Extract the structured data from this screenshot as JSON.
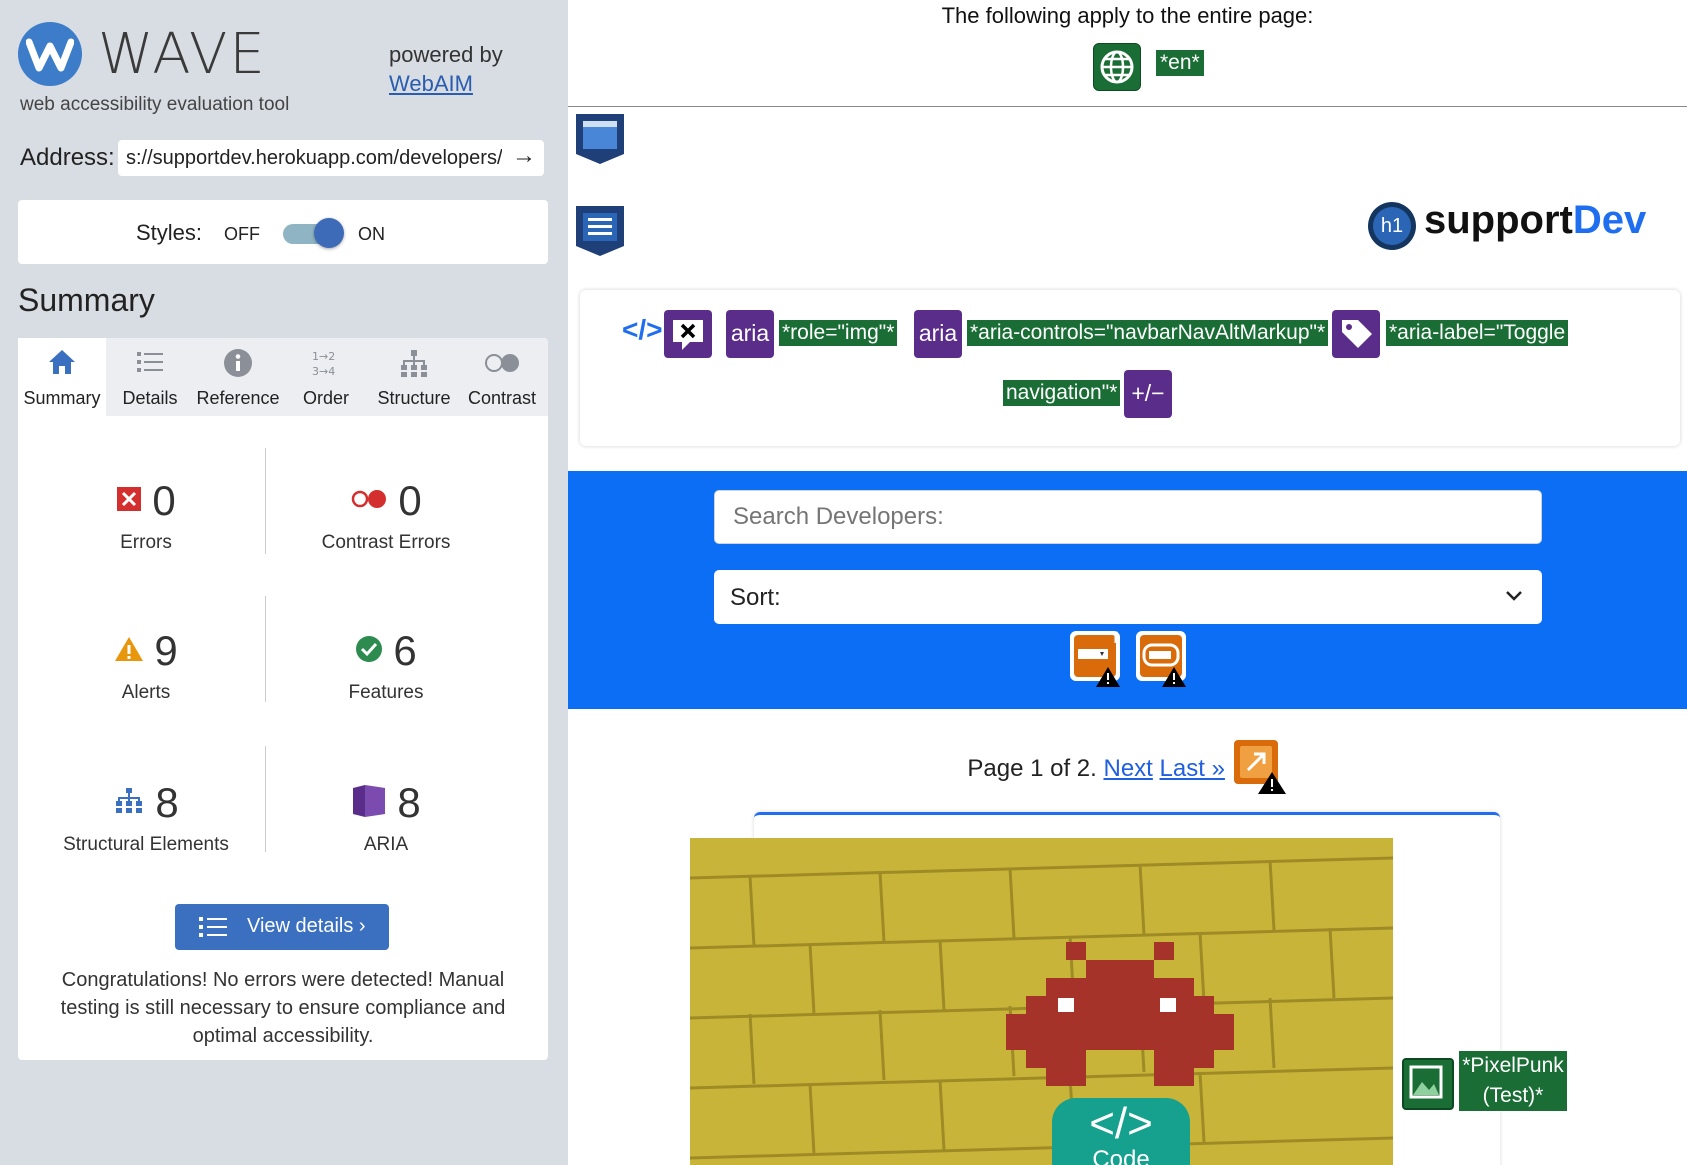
{
  "sidebar": {
    "brand": "WAVE",
    "tagline": "web accessibility evaluation tool",
    "powered_by": "powered by",
    "webaim_link": "WebAIM",
    "address_label": "Address:",
    "address_value": "s://supportdev.herokuapp.com/developers/",
    "styles_label": "Styles:",
    "styles_off": "OFF",
    "styles_on": "ON",
    "summary_heading": "Summary",
    "tabs": [
      {
        "label": "Summary",
        "icon": "home-icon"
      },
      {
        "label": "Details",
        "icon": "list-icon"
      },
      {
        "label": "Reference",
        "icon": "info-icon"
      },
      {
        "label": "Order",
        "icon": "order-icon"
      },
      {
        "label": "Structure",
        "icon": "structure-icon"
      },
      {
        "label": "Contrast",
        "icon": "contrast-icon"
      }
    ],
    "stats": {
      "errors": {
        "value": "0",
        "label": "Errors"
      },
      "contrast_errors": {
        "value": "0",
        "label": "Contrast Errors"
      },
      "alerts": {
        "value": "9",
        "label": "Alerts"
      },
      "features": {
        "value": "6",
        "label": "Features"
      },
      "structural": {
        "value": "8",
        "label": "Structural Elements"
      },
      "aria": {
        "value": "8",
        "label": "ARIA"
      }
    },
    "view_details": "View details ›",
    "congrats": "Congratulations! No errors were detected! Manual testing is still necessary to ensure compliance and optimal accessibility."
  },
  "main": {
    "apply_text": "The following apply to the entire page:",
    "lang_tag": "*en*",
    "brand_support": "support",
    "brand_dev": "Dev",
    "h1_badge": "h1",
    "nav_tags": {
      "role": "*role=\"img\"*",
      "aria_controls": "*aria-controls=\"navbarNavAltMarkup\"*",
      "aria_label_1": "*aria-label=\"Toggle",
      "aria_label_2": "navigation\"*",
      "aria_text": "aria",
      "expand_text": "+/−"
    },
    "search_placeholder": "Search Developers:",
    "sort_label": "Sort:",
    "pager_prefix": "Page 1 of 2.",
    "pager_next": "Next",
    "pager_last": "Last »",
    "code_glyph": "</>",
    "code_label": "Code",
    "pixel_tag_1": "*PixelPunk",
    "pixel_tag_2": "(Test)*"
  },
  "colors": {
    "wave_blue": "#3d7cc9",
    "feature_green": "#1a6e35",
    "aria_purple": "#5a2d8a",
    "page_blue": "#0b6ef5",
    "alert_orange": "#d96b0b"
  }
}
